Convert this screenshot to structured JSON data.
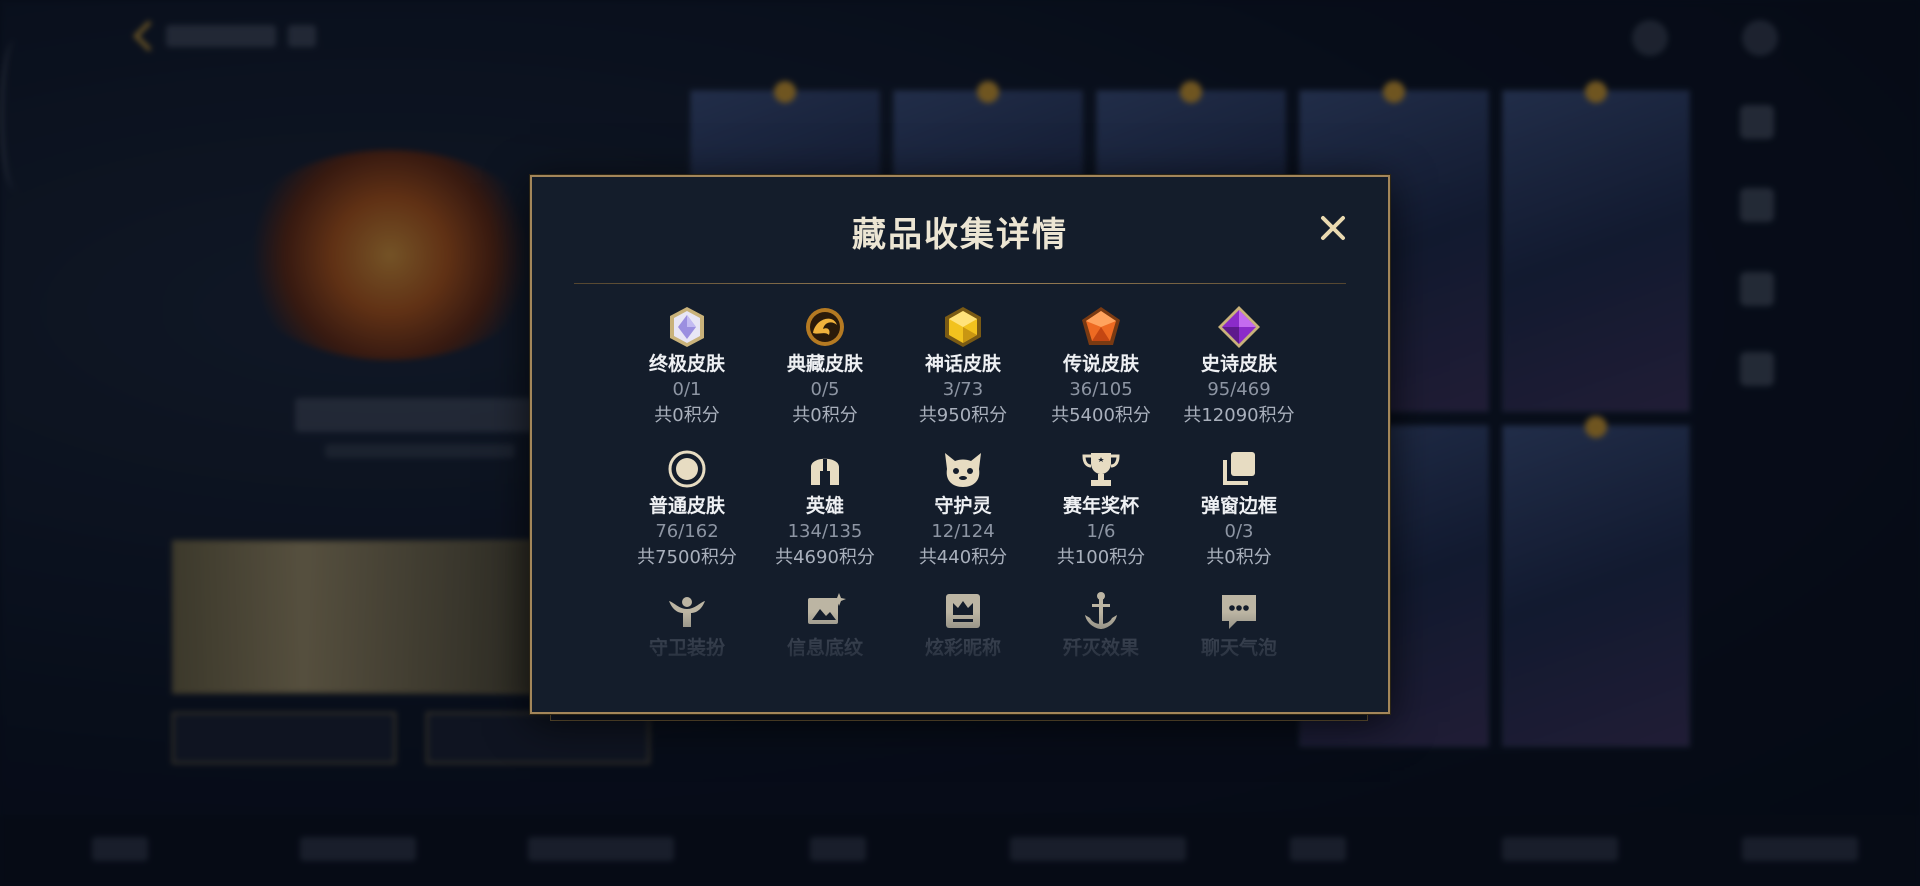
{
  "modal": {
    "title": "藏品收集详情"
  },
  "collections": [
    {
      "name": "终极皮肤",
      "count": "0/1",
      "score": "共0积分",
      "icon": "ultimate-skin-gem-icon"
    },
    {
      "name": "典藏皮肤",
      "count": "0/5",
      "score": "共0积分",
      "icon": "prestige-skin-dragon-icon"
    },
    {
      "name": "神话皮肤",
      "count": "3/73",
      "score": "共950积分",
      "icon": "mythic-skin-gem-icon"
    },
    {
      "name": "传说皮肤",
      "count": "36/105",
      "score": "共5400积分",
      "icon": "legendary-skin-gem-icon"
    },
    {
      "name": "史诗皮肤",
      "count": "95/469",
      "score": "共12090积分",
      "icon": "epic-skin-gem-icon"
    },
    {
      "name": "普通皮肤",
      "count": "76/162",
      "score": "共7500积分",
      "icon": "standard-skin-circle-icon"
    },
    {
      "name": "英雄",
      "count": "134/135",
      "score": "共4690积分",
      "icon": "champion-helmet-icon"
    },
    {
      "name": "守护灵",
      "count": "12/124",
      "score": "共440积分",
      "icon": "little-legend-icon"
    },
    {
      "name": "赛年奖杯",
      "count": "1/6",
      "score": "共100积分",
      "icon": "season-trophy-icon"
    },
    {
      "name": "弹窗边框",
      "count": "0/3",
      "score": "共0积分",
      "icon": "popup-frame-icon"
    },
    {
      "name": "守卫装扮",
      "icon": "ward-skin-icon"
    },
    {
      "name": "信息底纹",
      "icon": "info-background-icon"
    },
    {
      "name": "炫彩昵称",
      "icon": "colorful-nickname-icon"
    },
    {
      "name": "歼灭效果",
      "icon": "elimination-effect-icon"
    },
    {
      "name": "聊天气泡",
      "icon": "chat-bubble-icon"
    }
  ],
  "colors": {
    "modal_bg": "#141d2b",
    "modal_border": "#a3865a",
    "title": "#ece5d3",
    "count": "#8d95a3"
  }
}
